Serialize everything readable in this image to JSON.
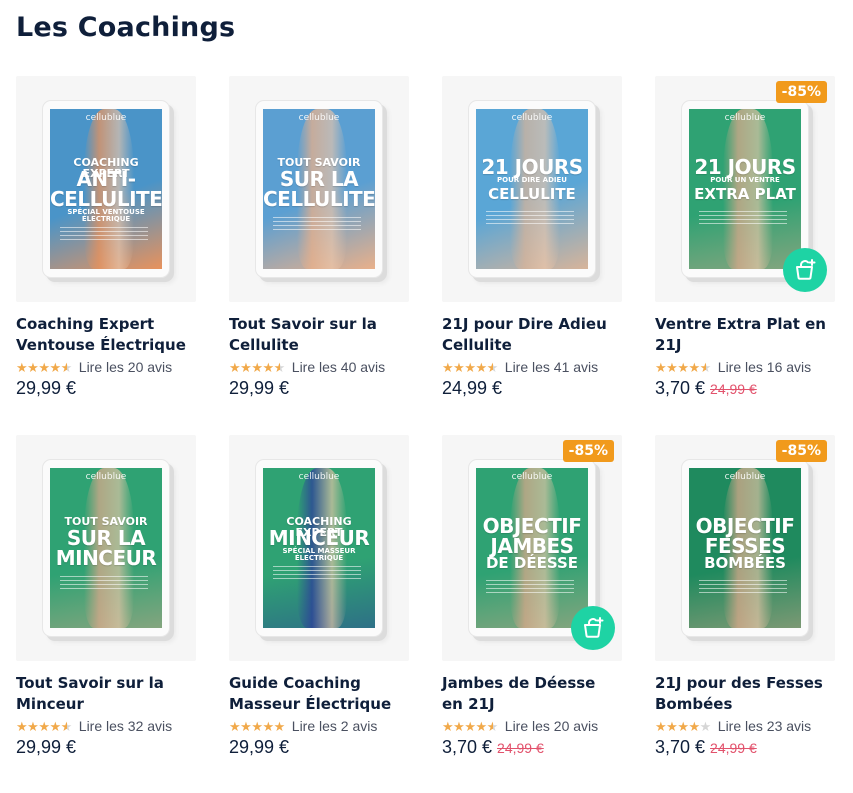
{
  "section": {
    "title": "Les Coachings"
  },
  "products": [
    {
      "name": "Coaching Expert Ventouse Électrique",
      "rating": 4.5,
      "reviews": "Lire les 20 avis",
      "price": "29,99 €",
      "old_price": "",
      "discount": "",
      "cover": {
        "brand": "cellublue",
        "top": "COACHING EXPERT",
        "big1": "ANTI-",
        "big2": "CELLULITE",
        "bottom": "SPÉCIAL VENTOUSE ÉLECTRIQUE",
        "bg": "#4a94c8",
        "accent": "#e8925c",
        "scheme": "blue"
      }
    },
    {
      "name": "Tout Savoir sur la Cellulite",
      "rating": 4.5,
      "reviews": "Lire les 40 avis",
      "price": "29,99 €",
      "old_price": "",
      "discount": "",
      "cover": {
        "brand": "cellublue",
        "top": "TOUT SAVOIR",
        "big1": "SUR LA",
        "big2": "CELLULITE",
        "bottom": "",
        "bg": "#5b9fd2",
        "accent": "#e9b08a",
        "scheme": "blue"
      }
    },
    {
      "name": "21J pour Dire Adieu Cellulite",
      "rating": 4.5,
      "reviews": "Lire les 41 avis",
      "price": "24,99 €",
      "old_price": "",
      "discount": "",
      "cover": {
        "brand": "cellublue",
        "top": "",
        "big1": "21 JOURS",
        "big2": "POUR DIRE ADIEU",
        "bottom": "CELLULITE",
        "bg": "#5aa6d6",
        "accent": "#d7b49a",
        "scheme": "blue"
      }
    },
    {
      "name": "Ventre Extra Plat en 21J",
      "rating": 4.5,
      "reviews": "Lire les 16 avis",
      "price": "3,70 €",
      "old_price": "24,99 €",
      "discount": "-85%",
      "cart": true,
      "cover": {
        "brand": "cellublue",
        "top": "",
        "big1": "21 JOURS",
        "big2": "POUR UN VENTRE",
        "bottom": "EXTRA PLAT",
        "bg": "#2fa273",
        "accent": "#d9a88a",
        "scheme": "green"
      }
    },
    {
      "name": "Tout Savoir sur la Minceur",
      "rating": 4.5,
      "reviews": "Lire les 32 avis",
      "price": "29,99 €",
      "old_price": "",
      "discount": "",
      "cover": {
        "brand": "cellublue",
        "top": "TOUT SAVOIR",
        "big1": "SUR LA",
        "big2": "MINCEUR",
        "bottom": "",
        "bg": "#2fa273",
        "accent": "#d9a88a",
        "scheme": "green"
      }
    },
    {
      "name": "Guide Coaching Masseur Électrique",
      "rating": 5,
      "reviews": "Lire les 2 avis",
      "price": "29,99 €",
      "old_price": "",
      "discount": "",
      "cover": {
        "brand": "cellublue",
        "top": "COACHING EXPERT",
        "big1": "MINCEUR",
        "big2": "",
        "bottom": "SPÉCIAL MASSEUR ÉLECTRIQUE",
        "bg": "#2fa273",
        "accent": "#2c3e9a",
        "scheme": "green"
      }
    },
    {
      "name": "Jambes de Déesse en 21J",
      "rating": 4.5,
      "reviews": "Lire les 20 avis",
      "price": "3,70 €",
      "old_price": "24,99 €",
      "discount": "-85%",
      "cart": true,
      "cover": {
        "brand": "cellublue",
        "top": "",
        "big1": "OBJECTIF",
        "big2": "JAMBES",
        "bottom": "DE DÉESSE",
        "bg": "#2fa273",
        "accent": "#d9a88a",
        "scheme": "green"
      }
    },
    {
      "name": "21J pour des Fesses Bombées",
      "rating": 4,
      "reviews": "Lire les 23 avis",
      "price": "3,70 €",
      "old_price": "24,99 €",
      "discount": "-85%",
      "cover": {
        "brand": "cellublue",
        "top": "",
        "big1": "OBJECTIF",
        "big2": "FESSES",
        "bottom": "BOMBÉES",
        "bg": "#1f8a5e",
        "accent": "#d9a88a",
        "scheme": "green"
      }
    }
  ],
  "icons": {
    "star": "star-icon",
    "cart": "shopping-bag-add-icon"
  },
  "colors": {
    "title": "#0f1f3a",
    "badge": "#f19a1c",
    "cart": "#1ed3a4",
    "old_price": "#e2526c",
    "star": "#f1a94a"
  }
}
